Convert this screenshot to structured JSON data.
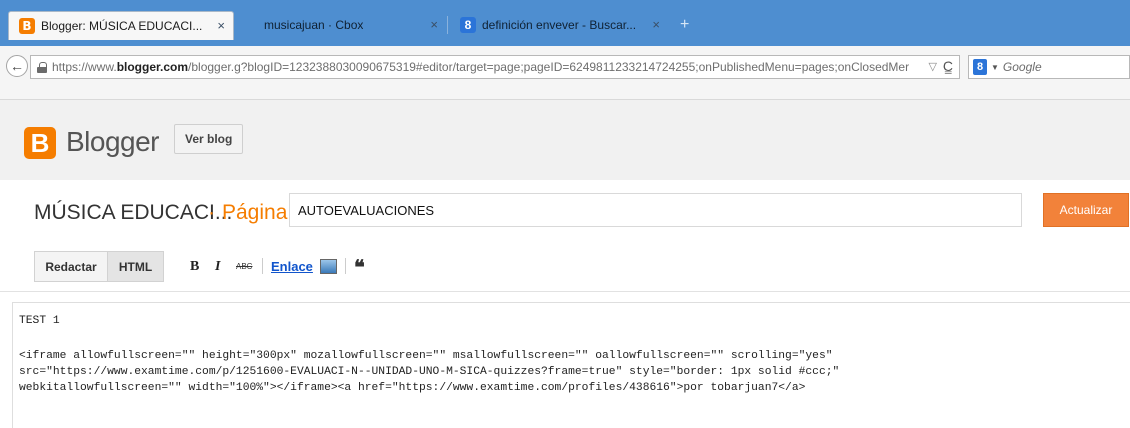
{
  "browser": {
    "tabs": [
      {
        "title": "Blogger: MÚSICA EDUCACI...",
        "icon": "blogger-icon",
        "active": true
      },
      {
        "title": "musicajuan · Cbox",
        "icon": "",
        "active": false
      },
      {
        "title": "definición envever - Buscar...",
        "icon": "google-icon",
        "active": false
      }
    ],
    "new_tab_label": "+",
    "close_label": "×",
    "url_prefix": "https://www.",
    "url_domain": "blogger.com",
    "url_rest": "/blogger.g?blogID=1232388030090675319#editor/target=page;pageID=6249811233214724255;onPublishedMenu=pages;onClosedMer",
    "search_placeholder": "Google",
    "search_engine_letter": "8"
  },
  "blogger": {
    "brand": "Blogger",
    "ver_blog": "Ver blog",
    "blog_name": "MÚSICA EDUCACI...",
    "separator": "·",
    "page_label": "Página",
    "page_title_value": "AUTOEVALUACIONES",
    "update_button": "Actualizar"
  },
  "toolbar": {
    "redactar": "Redactar",
    "html": "HTML",
    "bold": "B",
    "italic": "I",
    "strike": "ABC",
    "link": "Enlace",
    "quote": "❝"
  },
  "editor": {
    "lines": [
      "TEST 1",
      "<iframe allowfullscreen=\"\" height=\"300px\" mozallowfullscreen=\"\" msallowfullscreen=\"\" oallowfullscreen=\"\" scrolling=\"yes\"",
      "src=\"https://www.examtime.com/p/1251600-EVALUACI-N--UNIDAD-UNO-M-SICA-quizzes?frame=true\" style=\"border: 1px solid #ccc;\"",
      "webkitallowfullscreen=\"\" width=\"100%\"></iframe><a href=\"https://www.examtime.com/profiles/438616\">por tobarjuan7</a>"
    ]
  },
  "colors": {
    "tabstrip": "#4e8ed0",
    "blogger_orange": "#f57d00",
    "update_button": "#f2823a",
    "link_blue": "#1155cc"
  }
}
